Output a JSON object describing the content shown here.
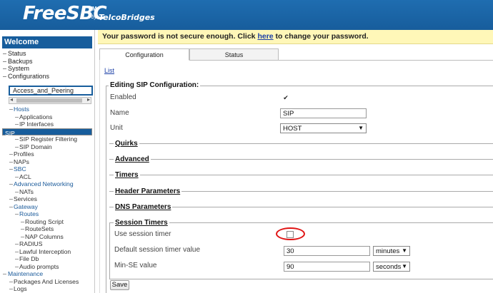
{
  "header": {
    "logo_text": "FreeSBC",
    "logo_tm": "TM",
    "logo_by": "by",
    "logo_brand": "TelcoBridges"
  },
  "sidebar": {
    "welcome": "Welcome",
    "top_items": [
      "Status",
      "Backups",
      "System",
      "Configurations"
    ],
    "config_name": "Access_and_Peering",
    "tree": [
      {
        "label": "Hosts",
        "level": 1,
        "link": true
      },
      {
        "label": "Applications",
        "level": 2
      },
      {
        "label": "IP Interfaces",
        "level": 2
      },
      {
        "label": "SIP",
        "level": 1,
        "selected": true
      },
      {
        "label": "SIP Register Filtering",
        "level": 2
      },
      {
        "label": "SIP Domain",
        "level": 2
      },
      {
        "label": "Profiles",
        "level": 1
      },
      {
        "label": "NAPs",
        "level": 1
      },
      {
        "label": "SBC",
        "level": 1,
        "link": true
      },
      {
        "label": "ACL",
        "level": 2
      },
      {
        "label": "Advanced Networking",
        "level": 1,
        "link": true
      },
      {
        "label": "NATs",
        "level": 2
      },
      {
        "label": "Services",
        "level": 1
      },
      {
        "label": "Gateway",
        "level": 1,
        "link": true
      },
      {
        "label": "Routes",
        "level": 2,
        "link": true
      },
      {
        "label": "Routing Script",
        "level": 3
      },
      {
        "label": "RouteSets",
        "level": 3
      },
      {
        "label": "NAP Columns",
        "level": 3
      },
      {
        "label": "RADIUS",
        "level": 2
      },
      {
        "label": "Lawful Interception",
        "level": 2
      },
      {
        "label": "File Db",
        "level": 2
      },
      {
        "label": "Audio prompts",
        "level": 2
      },
      {
        "label": "Maintenance",
        "level": 0,
        "link": true
      },
      {
        "label": "Packages And Licenses",
        "level": 1
      },
      {
        "label": "Logs",
        "level": 1
      }
    ]
  },
  "warning": {
    "prefix": "Your password is not secure enough. Click ",
    "link": "here",
    "suffix": " to change your password."
  },
  "tabs": [
    {
      "label": "Configuration",
      "active": true
    },
    {
      "label": "Status",
      "active": false
    }
  ],
  "list_link": "List",
  "form": {
    "legend": "Editing SIP Configuration:",
    "enabled_label": "Enabled",
    "enabled_checked": true,
    "name_label": "Name",
    "name_value": "SIP",
    "unit_label": "Unit",
    "unit_value": "HOST",
    "sections": [
      "Quirks",
      "Advanced",
      "Timers",
      "Header Parameters",
      "DNS Parameters"
    ],
    "session": {
      "legend": "Session Timers",
      "use_label": "Use session timer",
      "use_checked": false,
      "default_label": "Default session timer value",
      "default_value": "30",
      "default_unit": "minutes",
      "minse_label": "Min-SE value",
      "minse_value": "90",
      "minse_unit": "seconds"
    },
    "save_label": "Save"
  },
  "colors": {
    "brand_blue": "#175d9c",
    "warning_bg": "#fff7b8",
    "highlight_ring": "#e01414"
  }
}
